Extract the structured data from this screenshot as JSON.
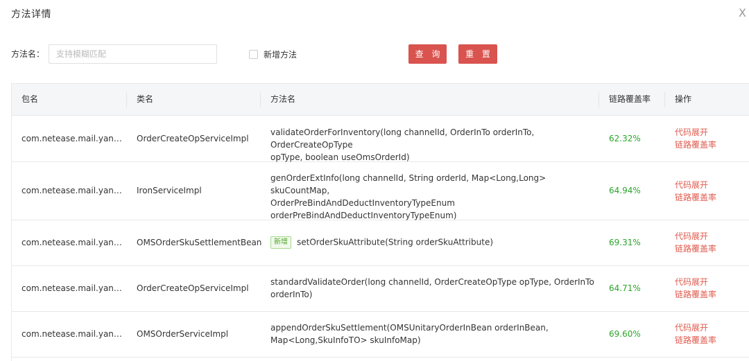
{
  "modal": {
    "title": "方法详情",
    "close_label": "X"
  },
  "filter": {
    "method_label": "方法名：",
    "method_placeholder": "支持模糊匹配",
    "method_value": "",
    "new_method_checkbox_label": "新增方法",
    "new_method_checked": false,
    "query_button": "查 询",
    "reset_button": "重 置"
  },
  "table": {
    "columns": [
      "包名",
      "类名",
      "方法名",
      "链路覆盖率",
      "操作"
    ],
    "op_labels": {
      "expand_code": "代码展开",
      "coverage": "链路覆盖率"
    },
    "new_tag_label": "新增",
    "rows": [
      {
        "package": "com.netease.mail.yanx…",
        "class_name": "OrderCreateOpServiceImpl",
        "method_lines": [
          "validateOrderForInventory(long channelId, OrderInTo orderInTo, OrderCreateOpType",
          "opType, boolean useOmsOrderId)"
        ],
        "is_new": false,
        "coverage_rate": "62.32%"
      },
      {
        "package": "com.netease.mail.yanx…",
        "class_name": "IronServiceImpl",
        "method_lines": [
          "genOrderExtInfo(long channelId, String orderId, Map<Long,Long> skuCountMap,",
          "OrderPreBindAndDeductInventoryTypeEnum",
          "orderPreBindAndDeductInventoryTypeEnum)"
        ],
        "is_new": false,
        "coverage_rate": "64.94%"
      },
      {
        "package": "com.netease.mail.yanx…",
        "class_name": "OMSOrderSkuSettlementBean",
        "method_lines": [
          "setOrderSkuAttribute(String orderSkuAttribute)"
        ],
        "is_new": true,
        "coverage_rate": "69.31%"
      },
      {
        "package": "com.netease.mail.yanx…",
        "class_name": "OrderCreateOpServiceImpl",
        "method_lines": [
          "standardValidateOrder(long channelId, OrderCreateOpType opType, OrderInTo",
          "orderInTo)"
        ],
        "is_new": false,
        "coverage_rate": "64.71%"
      },
      {
        "package": "com.netease.mail.yanx…",
        "class_name": "OMSOrderServiceImpl",
        "method_lines": [
          "appendOrderSkuSettlement(OMSUnitaryOrderInBean orderInBean,",
          "Map<Long,SkuInfoTO> skuInfoMap)"
        ],
        "is_new": false,
        "coverage_rate": "69.60%"
      }
    ]
  },
  "colors": {
    "accent_button": "#d9534f",
    "coverage_text": "#2aa52a",
    "op_link": "#e05a4e",
    "header_bg": "#f5f6f7"
  }
}
